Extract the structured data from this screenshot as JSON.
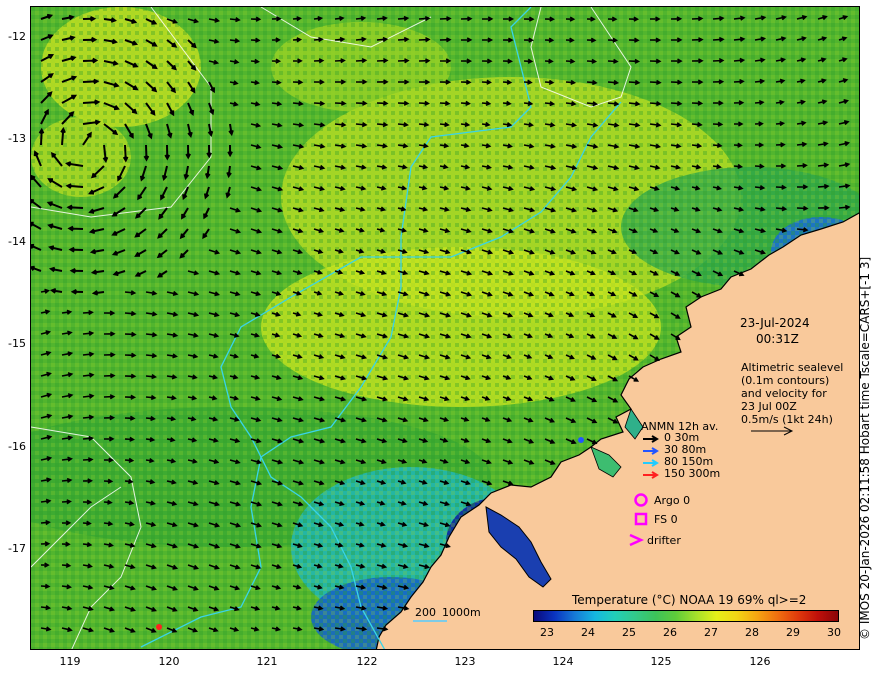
{
  "map": {
    "y_ticks": [
      "-12",
      "-13",
      "-14",
      "-15",
      "-16",
      "-17"
    ],
    "x_ticks": [
      "119",
      "120",
      "121",
      "122",
      "123",
      "124",
      "125",
      "126"
    ],
    "land_color": "#f9c99b",
    "arrow_color": "#000000",
    "current_color": "#000000"
  },
  "annotations": {
    "date": "23-Jul-2024",
    "time": "00:31Z",
    "altimetry_lines": [
      "Altimetric sealevel",
      "(0.1m contours)",
      "and velocity for",
      "23 Jul 00Z",
      "0.5m/s (1kt 24h)"
    ]
  },
  "legend": {
    "title": "ANMN 12h av.",
    "rows": [
      {
        "label": "0 30m",
        "color": "#000000"
      },
      {
        "label": "30 80m",
        "color": "#2255ff"
      },
      {
        "label": "80 150m",
        "color": "#22ccff"
      },
      {
        "label": "150 300m",
        "color": "#ff2020"
      }
    ],
    "argo": "Argo 0",
    "fs": "FS 0",
    "drifter": "drifter",
    "marker_color": "#ff00ff"
  },
  "bathymetry_legend": {
    "label_200": "200",
    "label_1000": "1000m",
    "line_color": "#55ccff"
  },
  "colorbar": {
    "title": "Temperature (°C) NOAA 19 69% ql>=2",
    "ticks": [
      "23",
      "24",
      "25",
      "26",
      "27",
      "28",
      "29",
      "30"
    ],
    "colors": [
      "#0b0a7a",
      "#0a33c0",
      "#1679d6",
      "#15b6e0",
      "#22cfb8",
      "#33c98a",
      "#3dc35a",
      "#5fcc3a",
      "#a4e02b",
      "#e4f019",
      "#f2d515",
      "#f5a512",
      "#f07010",
      "#e03b0c",
      "#c0100a",
      "#8a0508"
    ]
  },
  "side_label": "© IMOS 20-Jan-2026 02:11:58 Hobart time Tscale=CARS+[-1 3]"
}
